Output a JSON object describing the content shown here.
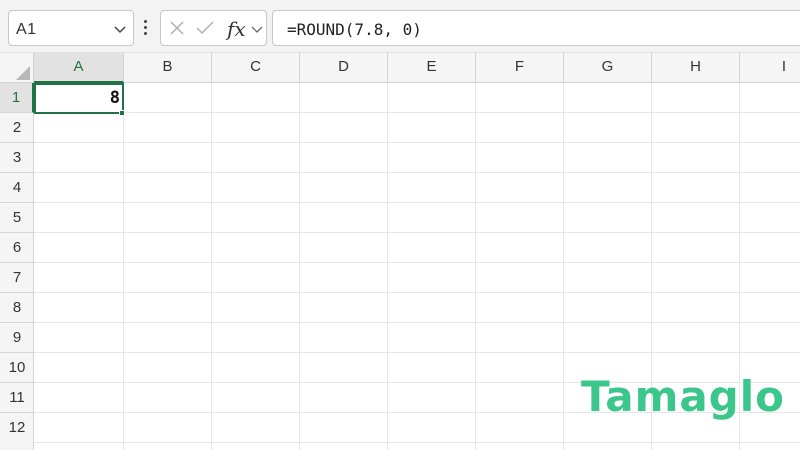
{
  "formula_bar": {
    "name_box": "A1",
    "fx_label": "fx",
    "formula": "=ROUND(7.8, 0)"
  },
  "icons": {
    "name_box_dropdown": "chevron-down-icon",
    "more_options": "kebab-icon",
    "cancel": "cancel-x-icon",
    "enter": "check-icon",
    "function_dropdown": "chevron-down-icon",
    "select_all": "select-all-triangle-icon"
  },
  "columns": [
    "A",
    "B",
    "C",
    "D",
    "E",
    "F",
    "G",
    "H",
    "I"
  ],
  "rows": [
    "1",
    "2",
    "3",
    "4",
    "5",
    "6",
    "7",
    "8",
    "9",
    "10",
    "11",
    "12"
  ],
  "cells": {
    "A1": "8"
  },
  "active_cell": "A1",
  "watermark": "Tamaglo",
  "colors": {
    "selection": "#217346",
    "watermark": "#3bc68c",
    "header_bg": "#f5f5f5"
  }
}
